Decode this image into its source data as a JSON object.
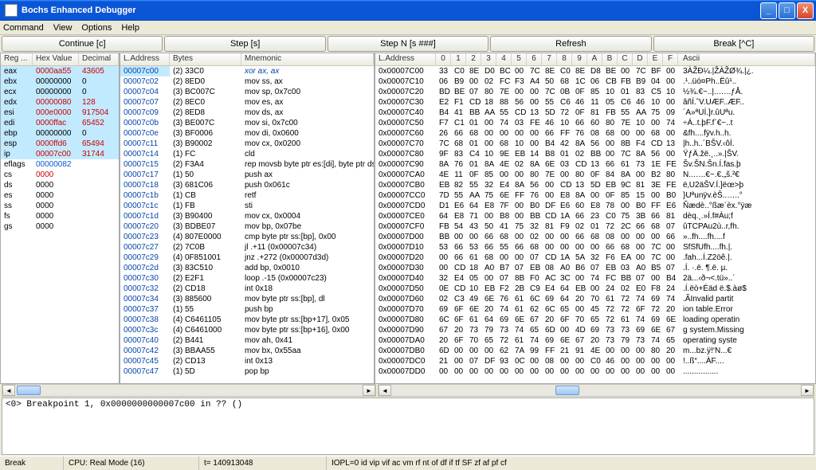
{
  "window": {
    "title": "Bochs Enhanced Debugger"
  },
  "menu": {
    "items": [
      "Command",
      "View",
      "Options",
      "Help"
    ]
  },
  "toolbar": {
    "continue": "Continue [c]",
    "step": "Step [s]",
    "stepn": "Step N [s ###]",
    "refresh": "Refresh",
    "break": "Break [^C]"
  },
  "regs": {
    "cols": [
      "Reg ...",
      "Hex Value",
      "Decimal"
    ],
    "rows": [
      {
        "n": "eax",
        "h": "0000aa55",
        "d": "43605",
        "c": "reg-red",
        "hl": true
      },
      {
        "n": "ebx",
        "h": "00000000",
        "d": "0",
        "hl": true
      },
      {
        "n": "ecx",
        "h": "00000000",
        "d": "0",
        "hl": true
      },
      {
        "n": "edx",
        "h": "00000080",
        "d": "128",
        "c": "reg-red",
        "hl": true
      },
      {
        "n": "esi",
        "h": "000e0000",
        "d": "917504",
        "c": "reg-red",
        "hl": true
      },
      {
        "n": "edi",
        "h": "0000ffac",
        "d": "65452",
        "c": "reg-red",
        "hl": true
      },
      {
        "n": "ebp",
        "h": "00000000",
        "d": "0",
        "hl": true
      },
      {
        "n": "esp",
        "h": "0000ffd6",
        "d": "65494",
        "c": "reg-red",
        "hl": true
      },
      {
        "n": "ip",
        "h": "00007c00",
        "d": "31744",
        "c": "reg-red",
        "hl": true
      },
      {
        "n": "eflags",
        "h": "00000082",
        "d": "",
        "c": "reg-blue"
      },
      {
        "n": "cs",
        "h": "0000",
        "d": "",
        "c": "reg-red"
      },
      {
        "n": "ds",
        "h": "0000",
        "d": ""
      },
      {
        "n": "es",
        "h": "0000",
        "d": ""
      },
      {
        "n": "ss",
        "h": "0000",
        "d": ""
      },
      {
        "n": "fs",
        "h": "0000",
        "d": ""
      },
      {
        "n": "gs",
        "h": "0000",
        "d": ""
      }
    ]
  },
  "dis": {
    "cols": [
      "L.Address",
      "Bytes",
      "Mnemonic"
    ],
    "rows": [
      {
        "a": "00007c00",
        "b": "(2) 33C0",
        "m": "xor ax, ax",
        "sel": true
      },
      {
        "a": "00007c02",
        "b": "(2) 8ED0",
        "m": "mov ss, ax"
      },
      {
        "a": "00007c04",
        "b": "(3) BC007C",
        "m": "mov sp, 0x7c00"
      },
      {
        "a": "00007c07",
        "b": "(2) 8EC0",
        "m": "mov es, ax"
      },
      {
        "a": "00007c09",
        "b": "(2) 8ED8",
        "m": "mov ds, ax"
      },
      {
        "a": "00007c0b",
        "b": "(3) BE007C",
        "m": "mov si, 0x7c00"
      },
      {
        "a": "00007c0e",
        "b": "(3) BF0006",
        "m": "mov di, 0x0600"
      },
      {
        "a": "00007c11",
        "b": "(3) B90002",
        "m": "mov cx, 0x0200"
      },
      {
        "a": "00007c14",
        "b": "(1) FC",
        "m": "cld"
      },
      {
        "a": "00007c15",
        "b": "(2) F3A4",
        "m": "rep movsb byte ptr es:[di], byte ptr ds:[si]"
      },
      {
        "a": "00007c17",
        "b": "(1) 50",
        "m": "push ax"
      },
      {
        "a": "00007c18",
        "b": "(3) 681C06",
        "m": "push 0x061c"
      },
      {
        "a": "00007c1b",
        "b": "(1) CB",
        "m": "retf"
      },
      {
        "a": "00007c1c",
        "b": "(1) FB",
        "m": "sti"
      },
      {
        "a": "00007c1d",
        "b": "(3) B90400",
        "m": "mov cx, 0x0004"
      },
      {
        "a": "00007c20",
        "b": "(3) BDBE07",
        "m": "mov bp, 0x07be"
      },
      {
        "a": "00007c23",
        "b": "(4) 807E0000",
        "m": "cmp byte ptr ss:[bp], 0x00"
      },
      {
        "a": "00007c27",
        "b": "(2) 7C0B",
        "m": "jl .+11 (0x00007c34)"
      },
      {
        "a": "00007c29",
        "b": "(4) 0F851001",
        "m": "jnz .+272 (0x00007d3d)"
      },
      {
        "a": "00007c2d",
        "b": "(3) 83C510",
        "m": "add bp, 0x0010"
      },
      {
        "a": "00007c30",
        "b": "(2) E2F1",
        "m": "loop .-15 (0x00007c23)"
      },
      {
        "a": "00007c32",
        "b": "(2) CD18",
        "m": "int 0x18"
      },
      {
        "a": "00007c34",
        "b": "(3) 885600",
        "m": "mov byte ptr ss:[bp], dl"
      },
      {
        "a": "00007c37",
        "b": "(1) 55",
        "m": "push bp"
      },
      {
        "a": "00007c38",
        "b": "(4) C6461105",
        "m": "mov byte ptr ss:[bp+17], 0x05"
      },
      {
        "a": "00007c3c",
        "b": "(4) C6461000",
        "m": "mov byte ptr ss:[bp+16], 0x00"
      },
      {
        "a": "00007c40",
        "b": "(2) B441",
        "m": "mov ah, 0x41"
      },
      {
        "a": "00007c42",
        "b": "(3) BBAA55",
        "m": "mov bx, 0x55aa"
      },
      {
        "a": "00007c45",
        "b": "(2) CD13",
        "m": "int 0x13"
      },
      {
        "a": "00007c47",
        "b": "(1) 5D",
        "m": "pop bp"
      }
    ]
  },
  "mem": {
    "addrcol": "L.Address",
    "hexcols": [
      "0",
      "1",
      "2",
      "3",
      "4",
      "5",
      "6",
      "7",
      "8",
      "9",
      "A",
      "B",
      "C",
      "D",
      "E",
      "F"
    ],
    "asccol": "Ascii",
    "rows": [
      {
        "a": "0x00007C00",
        "b": [
          "33",
          "C0",
          "8E",
          "D0",
          "BC",
          "00",
          "7C",
          "8E",
          "C0",
          "8E",
          "D8",
          "BE",
          "00",
          "7C",
          "BF",
          "00"
        ],
        "s": "3ÀŽÐ¼.|ŽÀŽØ¾.|¿."
      },
      {
        "a": "0x00007C10",
        "b": [
          "06",
          "B9",
          "00",
          "02",
          "FC",
          "F3",
          "A4",
          "50",
          "68",
          "1C",
          "06",
          "CB",
          "FB",
          "B9",
          "04",
          "00"
        ],
        "s": ".¹..üó¤Ph..Ëû¹.."
      },
      {
        "a": "0x00007C20",
        "b": [
          "BD",
          "BE",
          "07",
          "80",
          "7E",
          "00",
          "00",
          "7C",
          "0B",
          "0F",
          "85",
          "10",
          "01",
          "83",
          "C5",
          "10"
        ],
        "s": "½¾.€~..|..…..ƒÅ."
      },
      {
        "a": "0x00007C30",
        "b": [
          "E2",
          "F1",
          "CD",
          "18",
          "88",
          "56",
          "00",
          "55",
          "C6",
          "46",
          "11",
          "05",
          "C6",
          "46",
          "10",
          "00"
        ],
        "s": "âñÍ.ˆV.UÆF..ÆF.."
      },
      {
        "a": "0x00007C40",
        "b": [
          "B4",
          "41",
          "BB",
          "AA",
          "55",
          "CD",
          "13",
          "5D",
          "72",
          "0F",
          "81",
          "FB",
          "55",
          "AA",
          "75",
          "09"
        ],
        "s": "´A»ªUÍ.]r.ûUªu."
      },
      {
        "a": "0x00007C50",
        "b": [
          "F7",
          "C1",
          "01",
          "00",
          "74",
          "03",
          "FE",
          "46",
          "10",
          "66",
          "60",
          "80",
          "7E",
          "10",
          "00",
          "74"
        ],
        "s": "÷Á..t.þF.f`€~..t"
      },
      {
        "a": "0x00007C60",
        "b": [
          "26",
          "66",
          "68",
          "00",
          "00",
          "00",
          "00",
          "66",
          "FF",
          "76",
          "08",
          "68",
          "00",
          "00",
          "68",
          "00"
        ],
        "s": "&fh....fÿv.h..h."
      },
      {
        "a": "0x00007C70",
        "b": [
          "7C",
          "68",
          "01",
          "00",
          "68",
          "10",
          "00",
          "B4",
          "42",
          "8A",
          "56",
          "00",
          "8B",
          "F4",
          "CD",
          "13"
        ],
        "s": "|h..h..´BŠV.‹ôÍ."
      },
      {
        "a": "0x00007C80",
        "b": [
          "9F",
          "83",
          "C4",
          "10",
          "9E",
          "EB",
          "14",
          "B8",
          "01",
          "02",
          "BB",
          "00",
          "7C",
          "8A",
          "56",
          "00"
        ],
        "s": "ŸƒÄ.žë.¸..».|ŠV."
      },
      {
        "a": "0x00007C90",
        "b": [
          "8A",
          "76",
          "01",
          "8A",
          "4E",
          "02",
          "8A",
          "6E",
          "03",
          "CD",
          "13",
          "66",
          "61",
          "73",
          "1E",
          "FE"
        ],
        "s": "Šv.ŠN.Šn.Í.fas.þ"
      },
      {
        "a": "0x00007CA0",
        "b": [
          "4E",
          "11",
          "0F",
          "85",
          "00",
          "00",
          "80",
          "7E",
          "00",
          "80",
          "0F",
          "84",
          "8A",
          "00",
          "B2",
          "80"
        ],
        "s": "N..…..€~.€.„š.²€"
      },
      {
        "a": "0x00007CB0",
        "b": [
          "EB",
          "82",
          "55",
          "32",
          "E4",
          "8A",
          "56",
          "00",
          "CD",
          "13",
          "5D",
          "EB",
          "9C",
          "81",
          "3E",
          "FE"
        ],
        "s": "ë‚U2äŠV.Í.]ëœ>þ"
      },
      {
        "a": "0x00007CC0",
        "b": [
          "7D",
          "55",
          "AA",
          "75",
          "6E",
          "FF",
          "76",
          "00",
          "E8",
          "8A",
          "00",
          "0F",
          "85",
          "15",
          "00",
          "B0"
        ],
        "s": "}Uªunÿv.èŠ..…..°"
      },
      {
        "a": "0x00007CD0",
        "b": [
          "D1",
          "E6",
          "64",
          "E8",
          "7F",
          "00",
          "B0",
          "DF",
          "E6",
          "60",
          "E8",
          "78",
          "00",
          "B0",
          "FF",
          "E6"
        ],
        "s": "Ñædè..°ßæ`èx.°ÿæ"
      },
      {
        "a": "0x00007CE0",
        "b": [
          "64",
          "E8",
          "71",
          "00",
          "B8",
          "00",
          "BB",
          "CD",
          "1A",
          "66",
          "23",
          "C0",
          "75",
          "3B",
          "66",
          "81"
        ],
        "s": "dèq.¸.»Í.f#Àu;f"
      },
      {
        "a": "0x00007CF0",
        "b": [
          "FB",
          "54",
          "43",
          "50",
          "41",
          "75",
          "32",
          "81",
          "F9",
          "02",
          "01",
          "72",
          "2C",
          "66",
          "68",
          "07"
        ],
        "s": "ûTCPAu2ù..r,fh."
      },
      {
        "a": "0x00007D00",
        "b": [
          "BB",
          "00",
          "00",
          "66",
          "68",
          "00",
          "02",
          "00",
          "00",
          "66",
          "68",
          "08",
          "00",
          "00",
          "00",
          "66"
        ],
        "s": "»..fh....fh....f"
      },
      {
        "a": "0x00007D10",
        "b": [
          "53",
          "66",
          "53",
          "66",
          "55",
          "66",
          "68",
          "00",
          "00",
          "00",
          "00",
          "66",
          "68",
          "00",
          "7C",
          "00"
        ],
        "s": "SfSfUfh....fh.|."
      },
      {
        "a": "0x00007D20",
        "b": [
          "00",
          "66",
          "61",
          "68",
          "00",
          "00",
          "07",
          "CD",
          "1A",
          "5A",
          "32",
          "F6",
          "EA",
          "00",
          "7C",
          "00"
        ],
        "s": ".fah...Í.Z2öê.|."
      },
      {
        "a": "0x00007D30",
        "b": [
          "00",
          "CD",
          "18",
          "A0",
          "B7",
          "07",
          "EB",
          "08",
          "A0",
          "B6",
          "07",
          "EB",
          "03",
          "A0",
          "B5",
          "07"
        ],
        "s": ".Í. ·.ë. ¶.ë. µ."
      },
      {
        "a": "0x00007D40",
        "b": [
          "32",
          "E4",
          "05",
          "00",
          "07",
          "8B",
          "F0",
          "AC",
          "3C",
          "00",
          "74",
          "FC",
          "BB",
          "07",
          "00",
          "B4"
        ],
        "s": "2ä...‹ð¬<.tü»..´"
      },
      {
        "a": "0x00007D50",
        "b": [
          "0E",
          "CD",
          "10",
          "EB",
          "F2",
          "2B",
          "C9",
          "E4",
          "64",
          "EB",
          "00",
          "24",
          "02",
          "E0",
          "F8",
          "24"
        ],
        "s": ".Í.ëò+Éäd ë.$.àø$"
      },
      {
        "a": "0x00007D60",
        "b": [
          "02",
          "C3",
          "49",
          "6E",
          "76",
          "61",
          "6C",
          "69",
          "64",
          "20",
          "70",
          "61",
          "72",
          "74",
          "69",
          "74"
        ],
        "s": ".ÃInvalid partit"
      },
      {
        "a": "0x00007D70",
        "b": [
          "69",
          "6F",
          "6E",
          "20",
          "74",
          "61",
          "62",
          "6C",
          "65",
          "00",
          "45",
          "72",
          "72",
          "6F",
          "72",
          "20"
        ],
        "s": "ion table.Error "
      },
      {
        "a": "0x00007D80",
        "b": [
          "6C",
          "6F",
          "61",
          "64",
          "69",
          "6E",
          "67",
          "20",
          "6F",
          "70",
          "65",
          "72",
          "61",
          "74",
          "69",
          "6E"
        ],
        "s": "loading operatin"
      },
      {
        "a": "0x00007D90",
        "b": [
          "67",
          "20",
          "73",
          "79",
          "73",
          "74",
          "65",
          "6D",
          "00",
          "4D",
          "69",
          "73",
          "73",
          "69",
          "6E",
          "67"
        ],
        "s": "g system.Missing"
      },
      {
        "a": "0x00007DA0",
        "b": [
          "20",
          "6F",
          "70",
          "65",
          "72",
          "61",
          "74",
          "69",
          "6E",
          "67",
          "20",
          "73",
          "79",
          "73",
          "74",
          "65"
        ],
        "s": " operating syste"
      },
      {
        "a": "0x00007DB0",
        "b": [
          "6D",
          "00",
          "00",
          "00",
          "62",
          "7A",
          "99",
          "FF",
          "21",
          "91",
          "4E",
          "00",
          "00",
          "00",
          "80",
          "20"
        ],
        "s": "m...bz.ÿ!‘N...€ "
      },
      {
        "a": "0x00007DC0",
        "b": [
          "21",
          "00",
          "07",
          "DF",
          "93",
          "0C",
          "00",
          "08",
          "00",
          "00",
          "C0",
          "46",
          "00",
          "00",
          "00",
          "00"
        ],
        "s": "!..ß“....ÀF...."
      },
      {
        "a": "0x00007DD0",
        "b": [
          "00",
          "00",
          "00",
          "00",
          "00",
          "00",
          "00",
          "00",
          "00",
          "00",
          "00",
          "00",
          "00",
          "00",
          "00",
          "00"
        ],
        "s": "................"
      }
    ]
  },
  "console": "<0> Breakpoint 1, 0x0000000000007c00 in ?? ()",
  "status": {
    "left": "Break",
    "cpu": "CPU: Real Mode (16)",
    "time": "t= 140913048",
    "flags": "IOPL=0 id vip vif ac vm rf nt of df if tf SF zf af pf cf"
  }
}
